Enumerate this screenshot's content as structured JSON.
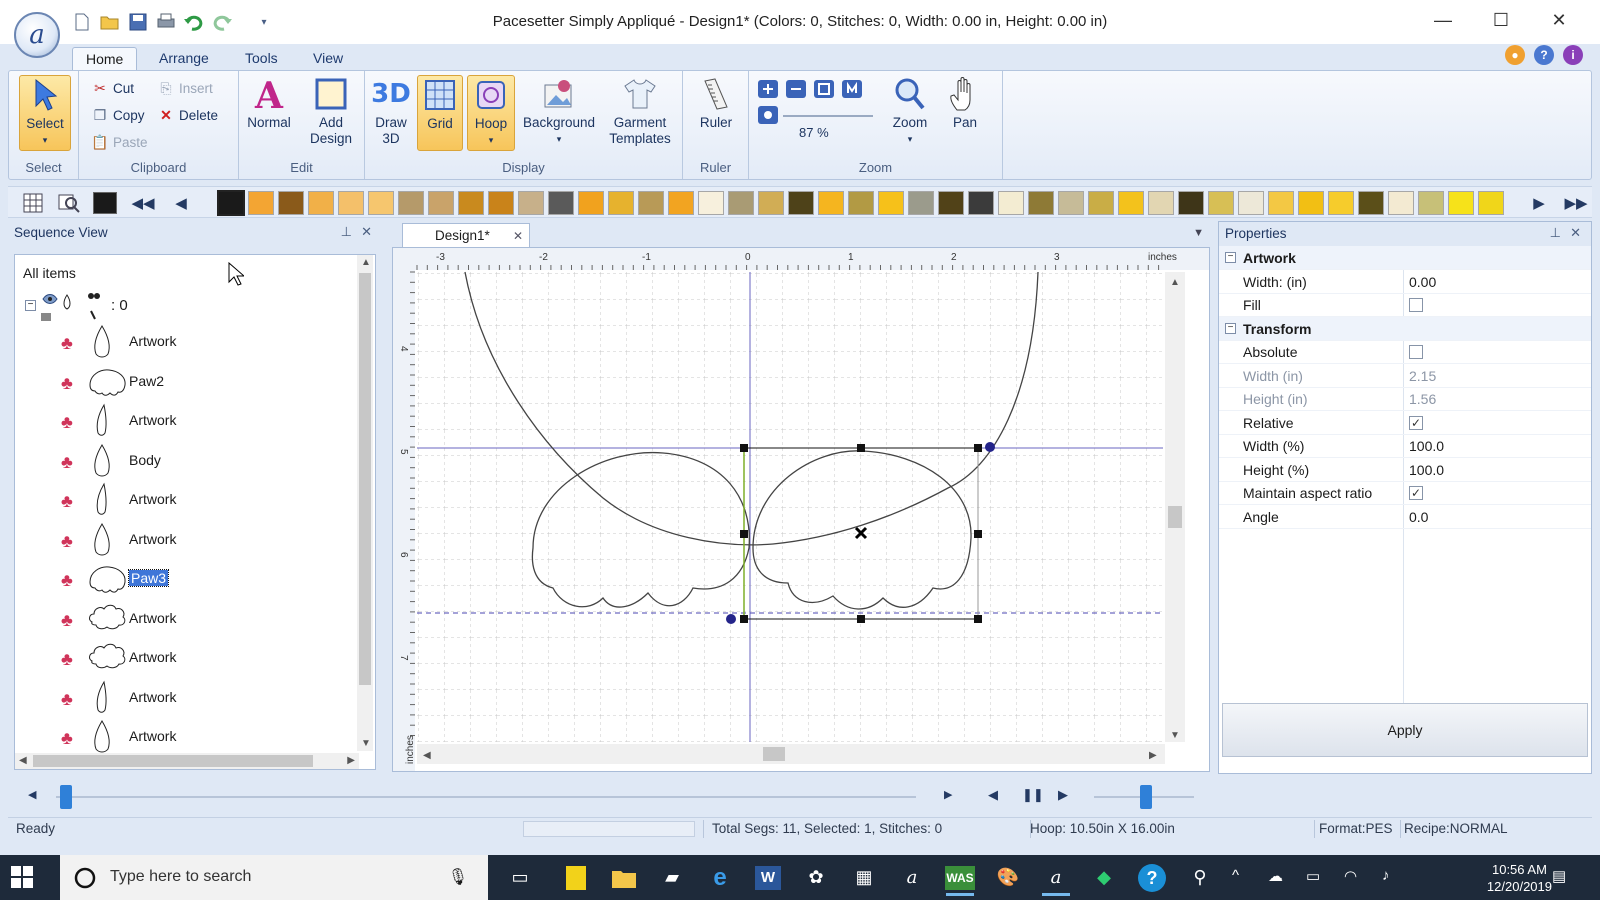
{
  "title_bar": {
    "title": "Pacesetter Simply Appliqué - Design1* (Colors: 0, Stitches: 0, Width: 0.00 in, Height: 0.00 in)",
    "logo_letter": "a",
    "quick_access": [
      "new-icon",
      "open-icon",
      "save-icon",
      "print-icon",
      "undo-icon",
      "redo-icon",
      "dropdown-icon"
    ],
    "window_controls": {
      "minimize": "—",
      "maximize": "☐",
      "close": "✕"
    }
  },
  "ribbon_tabs": [
    "Home",
    "Arrange",
    "Tools",
    "View"
  ],
  "ribbon": {
    "select_group": {
      "label": "Select",
      "select_btn": "Select"
    },
    "clipboard_group": {
      "label": "Clipboard",
      "cut": "Cut",
      "copy": "Copy",
      "paste": "Paste",
      "insert": "Insert",
      "delete": "Delete"
    },
    "edit_group": {
      "label": "Edit",
      "normal": "Normal",
      "add_design_1": "Add",
      "add_design_2": "Design"
    },
    "display_group": {
      "label": "Display",
      "draw3d_1": "Draw",
      "draw3d_2": "3D",
      "draw3d_icon": "3D",
      "grid": "Grid",
      "hoop": "Hoop",
      "background": "Background",
      "garment_1": "Garment",
      "garment_2": "Templates"
    },
    "ruler_group": {
      "label": "Ruler",
      "ruler": "Ruler"
    },
    "zoom_group": {
      "label": "Zoom",
      "zoom_level": "87 %",
      "zoom": "Zoom",
      "pan": "Pan"
    }
  },
  "color_strip": {
    "swatches": [
      "#1a1a1a",
      "#f3a533",
      "#8a5a1a",
      "#f1b048",
      "#f4c06a",
      "#f6c66e",
      "#b59a6a",
      "#c9a36a",
      "#c98a1e",
      "#c9831a",
      "#c7b08a",
      "#5a5a5a",
      "#f1a21e",
      "#e6b22e",
      "#b89a57",
      "#f2a421",
      "#f7f0dd",
      "#a99b74",
      "#d1ad55",
      "#4e4219",
      "#f5b51f",
      "#b29a44",
      "#f6c11a",
      "#9b9b8c",
      "#514218",
      "#3b3b3b",
      "#f3ecd2",
      "#8e7a36",
      "#c6bb98",
      "#c9ad46",
      "#f3c21c",
      "#e2d6b2",
      "#3e3518",
      "#d7bf55",
      "#ede8d8",
      "#f3c844",
      "#f2bf14",
      "#f6cc2c",
      "#5b4f19",
      "#f3ead2",
      "#c7c078",
      "#f6e21a",
      "#f0d61a"
    ]
  },
  "sequence_view": {
    "title": "Sequence View",
    "root_label": "All items",
    "root_count": ": 0",
    "items": [
      {
        "label": "Artwork",
        "shape": "drop"
      },
      {
        "label": "Paw2",
        "shape": "paw"
      },
      {
        "label": "Artwork",
        "shape": "drop-thin"
      },
      {
        "label": "Body",
        "shape": "drop"
      },
      {
        "label": "Artwork",
        "shape": "drop-thin"
      },
      {
        "label": "Artwork",
        "shape": "drop"
      },
      {
        "label": "Paw3",
        "shape": "paw",
        "selected": true
      },
      {
        "label": "Artwork",
        "shape": "cloud"
      },
      {
        "label": "Artwork",
        "shape": "cloud"
      },
      {
        "label": "Artwork",
        "shape": "drop-thin"
      },
      {
        "label": "Artwork",
        "shape": "drop"
      }
    ]
  },
  "canvas": {
    "tab_label": "Design1*",
    "ruler_units": "inches",
    "ruler_units_vertical": "inches",
    "x_ticks": [
      "-3",
      "-2",
      "-1",
      "0",
      "1",
      "2",
      "3"
    ],
    "y_ticks": [
      "4",
      "5",
      "6",
      "7"
    ]
  },
  "properties": {
    "title": "Properties",
    "rows": [
      {
        "name": "Artwork",
        "category": true
      },
      {
        "name": "Width: (in)",
        "value": "0.00"
      },
      {
        "name": "Fill",
        "checkbox": false
      },
      {
        "name": "Transform",
        "category": true
      },
      {
        "name": "Absolute",
        "checkbox": false
      },
      {
        "name": "Width (in)",
        "value": "2.15",
        "disabled": true
      },
      {
        "name": "Height (in)",
        "value": "1.56",
        "disabled": true
      },
      {
        "name": "Relative",
        "checkbox": true
      },
      {
        "name": "Width (%)",
        "value": "100.0"
      },
      {
        "name": "Height (%)",
        "value": "100.0"
      },
      {
        "name": "Maintain aspect ratio",
        "checkbox": true
      },
      {
        "name": "Angle",
        "value": "0.0"
      }
    ],
    "apply": "Apply"
  },
  "status_bar": {
    "ready": "Ready",
    "segments": "Total Segs: 11, Selected: 1, Stitches: 0",
    "hoop": "Hoop: 10.50in X 16.00in",
    "format": "Format:PES",
    "recipe": "Recipe:NORMAL"
  },
  "taskbar": {
    "search_placeholder": "Type here to search",
    "time": "10:56 AM",
    "date": "12/20/2019"
  },
  "colors": {
    "accent": "#3f76d8",
    "ribbon_bg": "#dfe8f5",
    "icon_pink": "#d0345a",
    "taskbar": "#1e2a3a"
  }
}
